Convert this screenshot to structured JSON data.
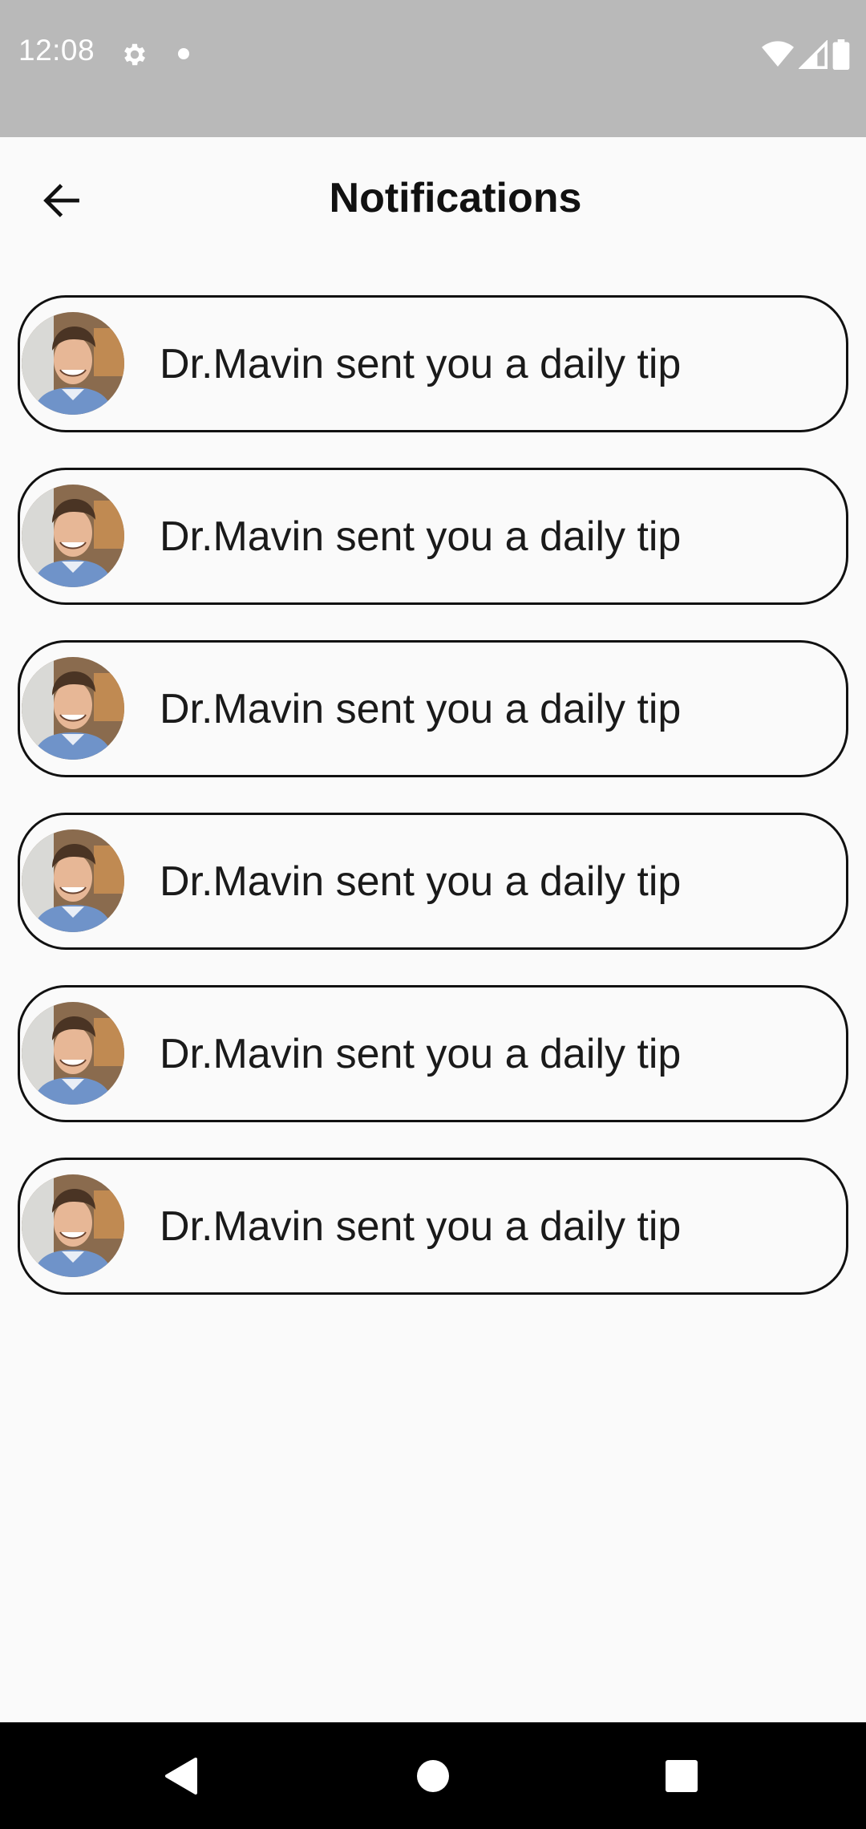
{
  "status_bar": {
    "time": "12:08",
    "icons": [
      "settings-gear-icon",
      "notification-dot-icon",
      "wifi-icon",
      "cellular-signal-icon",
      "battery-icon"
    ],
    "background": "#b9b9b9"
  },
  "header": {
    "title": "Notifications",
    "back_icon": "arrow-left-icon"
  },
  "notifications": [
    {
      "text": "Dr.Mavin sent you a daily tip",
      "avatar": "doctor-avatar"
    },
    {
      "text": "Dr.Mavin sent you a daily tip",
      "avatar": "doctor-avatar"
    },
    {
      "text": "Dr.Mavin sent you a daily tip",
      "avatar": "doctor-avatar"
    },
    {
      "text": "Dr.Mavin sent you a daily tip",
      "avatar": "doctor-avatar"
    },
    {
      "text": "Dr.Mavin sent you a daily tip",
      "avatar": "doctor-avatar"
    },
    {
      "text": "Dr.Mavin sent you a daily tip",
      "avatar": "doctor-avatar"
    }
  ],
  "nav_bar": {
    "buttons": [
      "back-triangle-icon",
      "home-circle-icon",
      "recents-square-icon"
    ]
  },
  "colors": {
    "background": "#fafafa",
    "card_border": "#111111",
    "text": "#1a1a1a"
  }
}
